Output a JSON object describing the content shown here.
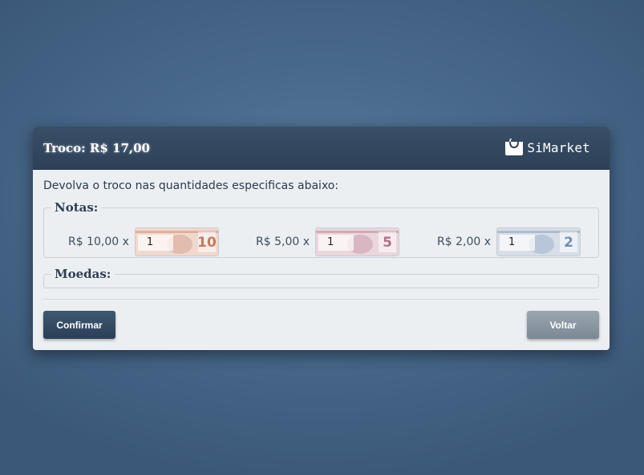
{
  "dialog": {
    "title": "Troco: R$ 17,00",
    "brand": {
      "name": "SiMarket",
      "icon": "shopping-bag-icon"
    },
    "instruction": "Devolva o troco nas quantidades especificas abaixo:"
  },
  "notas": {
    "legend": "Notas:",
    "items": [
      {
        "label": "R$ 10,00 x",
        "quantity": "1",
        "denomination": "10",
        "tint": "#e8a17e",
        "accent": "#b8664a"
      },
      {
        "label": "R$ 5,00 x",
        "quantity": "1",
        "denomination": "5",
        "tint": "#d79aa8",
        "accent": "#a35b77"
      },
      {
        "label": "R$ 2,00 x",
        "quantity": "1",
        "denomination": "2",
        "tint": "#9fb3cc",
        "accent": "#5d7ea6"
      }
    ]
  },
  "moedas": {
    "legend": "Moedas:",
    "items": []
  },
  "buttons": {
    "confirm": "Confirmar",
    "back": "Voltar"
  },
  "colors": {
    "header_bg": "#2d4157",
    "body_bg": "#eceff2",
    "confirm_bg": "#2b3f56",
    "back_bg": "#7c8893"
  }
}
